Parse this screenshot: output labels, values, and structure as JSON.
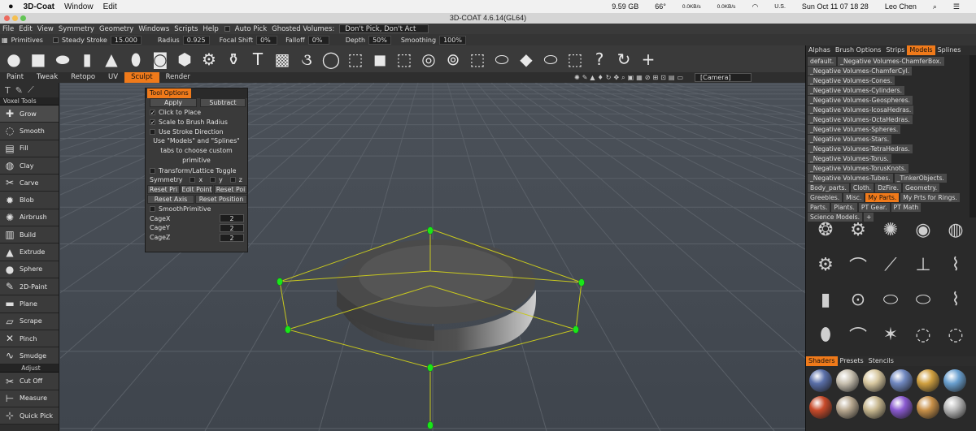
{
  "mac_menubar": {
    "apple": "",
    "app_name": "3D-Coat",
    "menus": [
      "Window",
      "Edit"
    ],
    "memory": "9.59 GB",
    "temperature": "66°",
    "net_up": "0.0KB/s",
    "net_down": "0.0KB/s",
    "locale": "U.S.",
    "datetime": "Sun Oct 11  07 18 28",
    "user": "Leo Chen"
  },
  "window_title": "3D-COAT 4.6.14(GL64)",
  "app_menu": [
    "File",
    "Edit",
    "View",
    "Symmetry",
    "Geometry",
    "Windows",
    "Scripts",
    "Help"
  ],
  "auto_pick_label": "Auto Pick",
  "ghosted_label": "Ghosted Volumes:",
  "ghosted_value": "Don't Pick, Don't Act",
  "brush_bar": {
    "primitives": "Primitives",
    "steady_stroke": "Steady Stroke",
    "steady_value": "15.000",
    "radius": "Radius",
    "radius_value": "0.925",
    "focal_shift": "Focal Shift",
    "focal_value": "0%",
    "falloff": "Falloff",
    "falloff_value": "0%",
    "depth": "Depth",
    "depth_value": "50%",
    "smoothing": "Smoothing",
    "smoothing_value": "100%"
  },
  "primitive_icons": [
    "sphere-icon",
    "cube-icon",
    "ellipsoid-icon",
    "cylinder-icon",
    "cone-icon",
    "capsule-icon",
    "tube-icon",
    "ngon-icon",
    "gear-icon",
    "vase-icon",
    "text-icon",
    "image-icon",
    "spiral-icon",
    "torus-icon",
    "cube-wire-icon",
    "box-icon",
    "cube-wire-2-icon",
    "ring-icon",
    "flat-ring-icon",
    "cube-wire-3-icon",
    "disk-icon",
    "plane-icon",
    "disk-2-icon",
    "cube-wire-4-icon",
    "question-icon",
    "redo-icon",
    "add-icon"
  ],
  "rooms": [
    "Paint",
    "Tweak",
    "Retopo",
    "UV",
    "Sculpt",
    "Render"
  ],
  "active_room": "Sculpt",
  "camera": "[Camera]",
  "left_toolbar": {
    "voxel_tools": "Voxel Tools",
    "tools": [
      "Grow",
      "Smooth",
      "Fill",
      "Clay",
      "Carve",
      "Blob",
      "Airbrush",
      "Build",
      "Extrude",
      "Sphere",
      "2D-Paint",
      "Plane",
      "Scrape",
      "Pinch",
      "Smudge"
    ],
    "adjust": "Adjust",
    "adjust_tools": [
      "Cut Off",
      "Measure",
      "Quick Pick"
    ]
  },
  "tool_options": {
    "title": "Tool Options",
    "apply": "Apply",
    "mode": "Subtract",
    "click_to_place": "Click to Place",
    "scale_to_brush": "Scale to Brush Radius",
    "use_stroke_dir": "Use Stroke Direction",
    "hint": "Use \"Models\" and \"Splines\" tabs to choose custom primitive",
    "transform_toggle": "Transform/Lattice Toggle",
    "symmetry": "Symmetry",
    "x": "x",
    "y": "y",
    "z": "z",
    "reset_pri": "Reset Pri",
    "edit_point": "Edit Point",
    "reset_poi": "Reset Poi",
    "reset_axis": "Reset Axis",
    "reset_position": "Reset Position",
    "smooth_primitive": "SmoothPrimitive",
    "cage_x": "CageX",
    "cage_y": "CageY",
    "cage_z": "CageZ",
    "cage_x_val": "2",
    "cage_y_val": "2",
    "cage_z_val": "2"
  },
  "right_panel": {
    "tabs": [
      "Alphas",
      "Brush Options",
      "Strips",
      "Models",
      "Splines"
    ],
    "active_tab": "Models",
    "folders": [
      "default.",
      "_Negative Volumes-ChamferBox.",
      "_Negative Volumes-ChamferCyl.",
      "_Negative Volumes-Cones.",
      "_Negative Volumes-Cylinders.",
      "_Negative Volumes-Geospheres.",
      "_Negative Volumes-IcosaHedras.",
      "_Negative Volumes-OctaHedras.",
      "_Negative Volumes-Spheres.",
      "_Negative Volumes-Stars.",
      "_Negative Volumes-TetraHedras.",
      "_Negative Volumes-Torus.",
      "_Negative Volumes-TorusKnots.",
      "_Negative Volumes-Tubes.",
      "_TinkerObjects.",
      "Body_parts.",
      "Cloth.",
      "DzFire.",
      "Geometry.",
      "Greebles.",
      "Misc.",
      "My Parts.",
      "My Prts for Rings.",
      "Parts.",
      "Plants.",
      "PT Gear.",
      "PT Math",
      "Science Models."
    ],
    "active_folder": "My Parts.",
    "bottom_tabs": [
      "Shaders",
      "Presets",
      "Stencils"
    ],
    "active_bottom_tab": "Shaders"
  },
  "colors": {
    "accent": "#f07a1a",
    "gizmo": "#19e619",
    "cage": "#c8c81e"
  }
}
